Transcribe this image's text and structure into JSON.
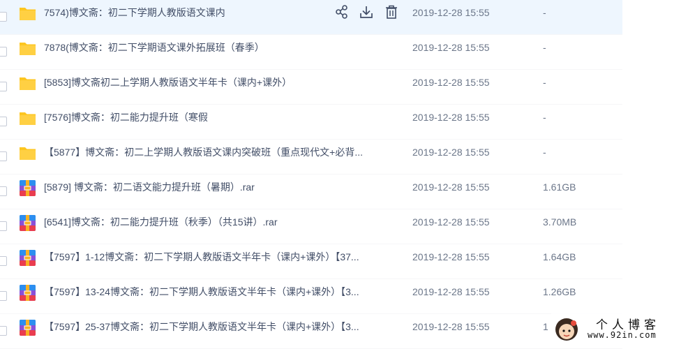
{
  "files": [
    {
      "name": "7574)博文斋：初二下学期人教版语文课内",
      "date": "2019-12-28 15:55",
      "size": "-",
      "type": "folder",
      "hover": true
    },
    {
      "name": "7878(博文斋：初二下学期语文课外拓展班（春季）",
      "date": "2019-12-28 15:55",
      "size": "-",
      "type": "folder"
    },
    {
      "name": "[5853]博文斋初二上学期人教版语文半年卡（课内+课外）",
      "date": "2019-12-28 15:55",
      "size": "-",
      "type": "folder"
    },
    {
      "name": "[7576]博文斋：初二能力提升班（寒假",
      "date": "2019-12-28 15:55",
      "size": "-",
      "type": "folder"
    },
    {
      "name": "【5877】博文斋：初二上学期人教版语文课内突破班（重点现代文+必背...",
      "date": "2019-12-28 15:55",
      "size": "-",
      "type": "folder"
    },
    {
      "name": "[5879] 博文斋：初二语文能力提升班（暑期）.rar",
      "date": "2019-12-28 15:55",
      "size": "1.61GB",
      "type": "archive"
    },
    {
      "name": "[6541]博文斋：初二能力提升班（秋季）（共15讲）.rar",
      "date": "2019-12-28 15:55",
      "size": "3.70MB",
      "type": "archive"
    },
    {
      "name": "【7597】1-12博文斋：初二下学期人教版语文半年卡（课内+课外）【37...",
      "date": "2019-12-28 15:55",
      "size": "1.64GB",
      "type": "archive"
    },
    {
      "name": "【7597】13-24博文斋：初二下学期人教版语文半年卡（课内+课外）【3...",
      "date": "2019-12-28 15:55",
      "size": "1.26GB",
      "type": "archive"
    },
    {
      "name": "【7597】25-37博文斋：初二下学期人教版语文半年卡（课内+课外）【3...",
      "date": "2019-12-28 15:55",
      "size": "1",
      "type": "archive"
    }
  ],
  "row_actions": [
    "share-icon",
    "download-icon",
    "delete-icon"
  ],
  "watermark": {
    "title": "个人博客",
    "url": "www.92in.com"
  },
  "colors": {
    "folder": "#fdc620",
    "hover_row": "#eef6fe",
    "text": "#424e67",
    "meta_text": "#6b7689",
    "archive_top": "#2d8ef0",
    "archive_bottom": "#ea3d4f",
    "archive_band": "#f9b222",
    "archive_side": "#3fb35a"
  }
}
